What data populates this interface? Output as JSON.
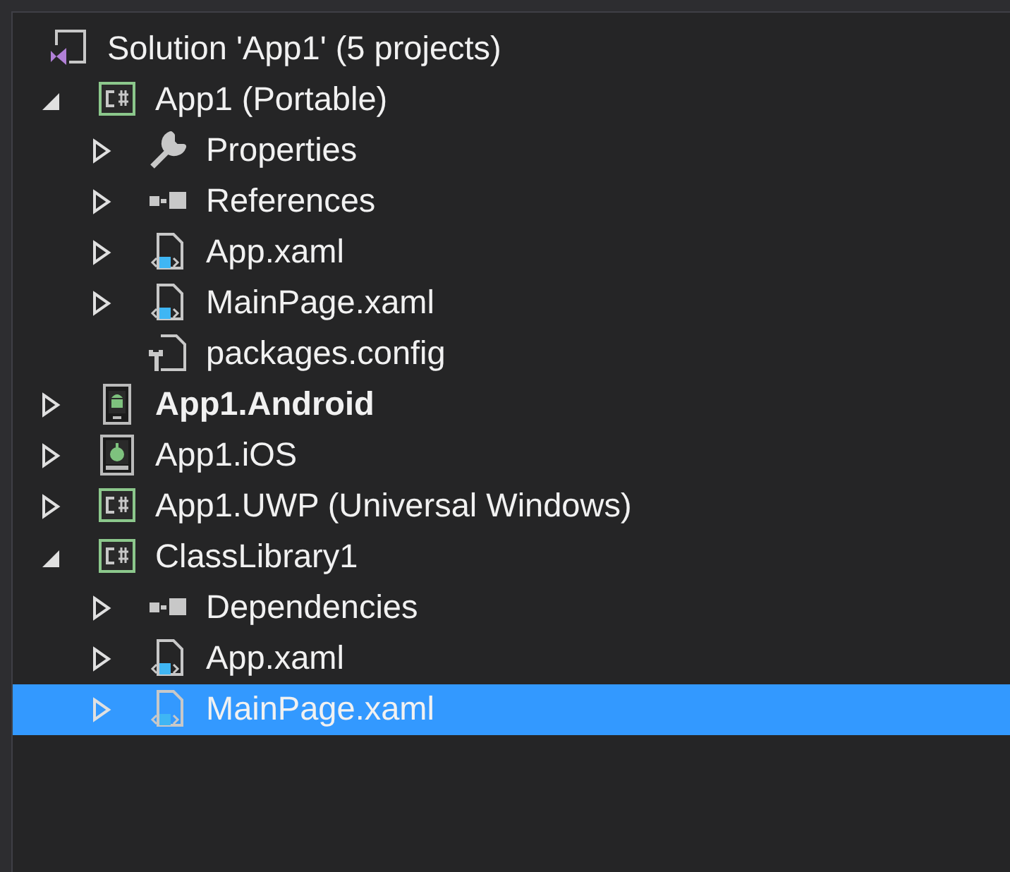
{
  "tree": [
    {
      "label": "Solution 'App1' (5 projects)",
      "kind": "solution",
      "bold": false,
      "selected": false,
      "children": [
        {
          "label": "App1 (Portable)",
          "kind": "csharp",
          "expanded": true,
          "bold": false,
          "selected": false,
          "children": [
            {
              "label": "Properties",
              "kind": "properties",
              "expanded": false,
              "bold": false,
              "selected": false
            },
            {
              "label": "References",
              "kind": "references",
              "expanded": false,
              "bold": false,
              "selected": false
            },
            {
              "label": "App.xaml",
              "kind": "xaml",
              "expanded": false,
              "bold": false,
              "selected": false
            },
            {
              "label": "MainPage.xaml",
              "kind": "xaml",
              "expanded": false,
              "bold": false,
              "selected": false
            },
            {
              "label": "packages.config",
              "kind": "config",
              "bold": false,
              "selected": false
            }
          ]
        },
        {
          "label": "App1.Android",
          "kind": "android",
          "expanded": false,
          "bold": true,
          "selected": false
        },
        {
          "label": "App1.iOS",
          "kind": "ios",
          "expanded": false,
          "bold": false,
          "selected": false
        },
        {
          "label": "App1.UWP (Universal Windows)",
          "kind": "csharp",
          "expanded": false,
          "bold": false,
          "selected": false
        },
        {
          "label": "ClassLibrary1",
          "kind": "csharp",
          "expanded": true,
          "bold": false,
          "selected": false,
          "children": [
            {
              "label": "Dependencies",
              "kind": "references",
              "expanded": false,
              "bold": false,
              "selected": false
            },
            {
              "label": "App.xaml",
              "kind": "xaml",
              "expanded": false,
              "bold": false,
              "selected": false
            },
            {
              "label": "MainPage.xaml",
              "kind": "xaml",
              "expanded": false,
              "bold": false,
              "selected": true
            }
          ]
        }
      ]
    }
  ]
}
